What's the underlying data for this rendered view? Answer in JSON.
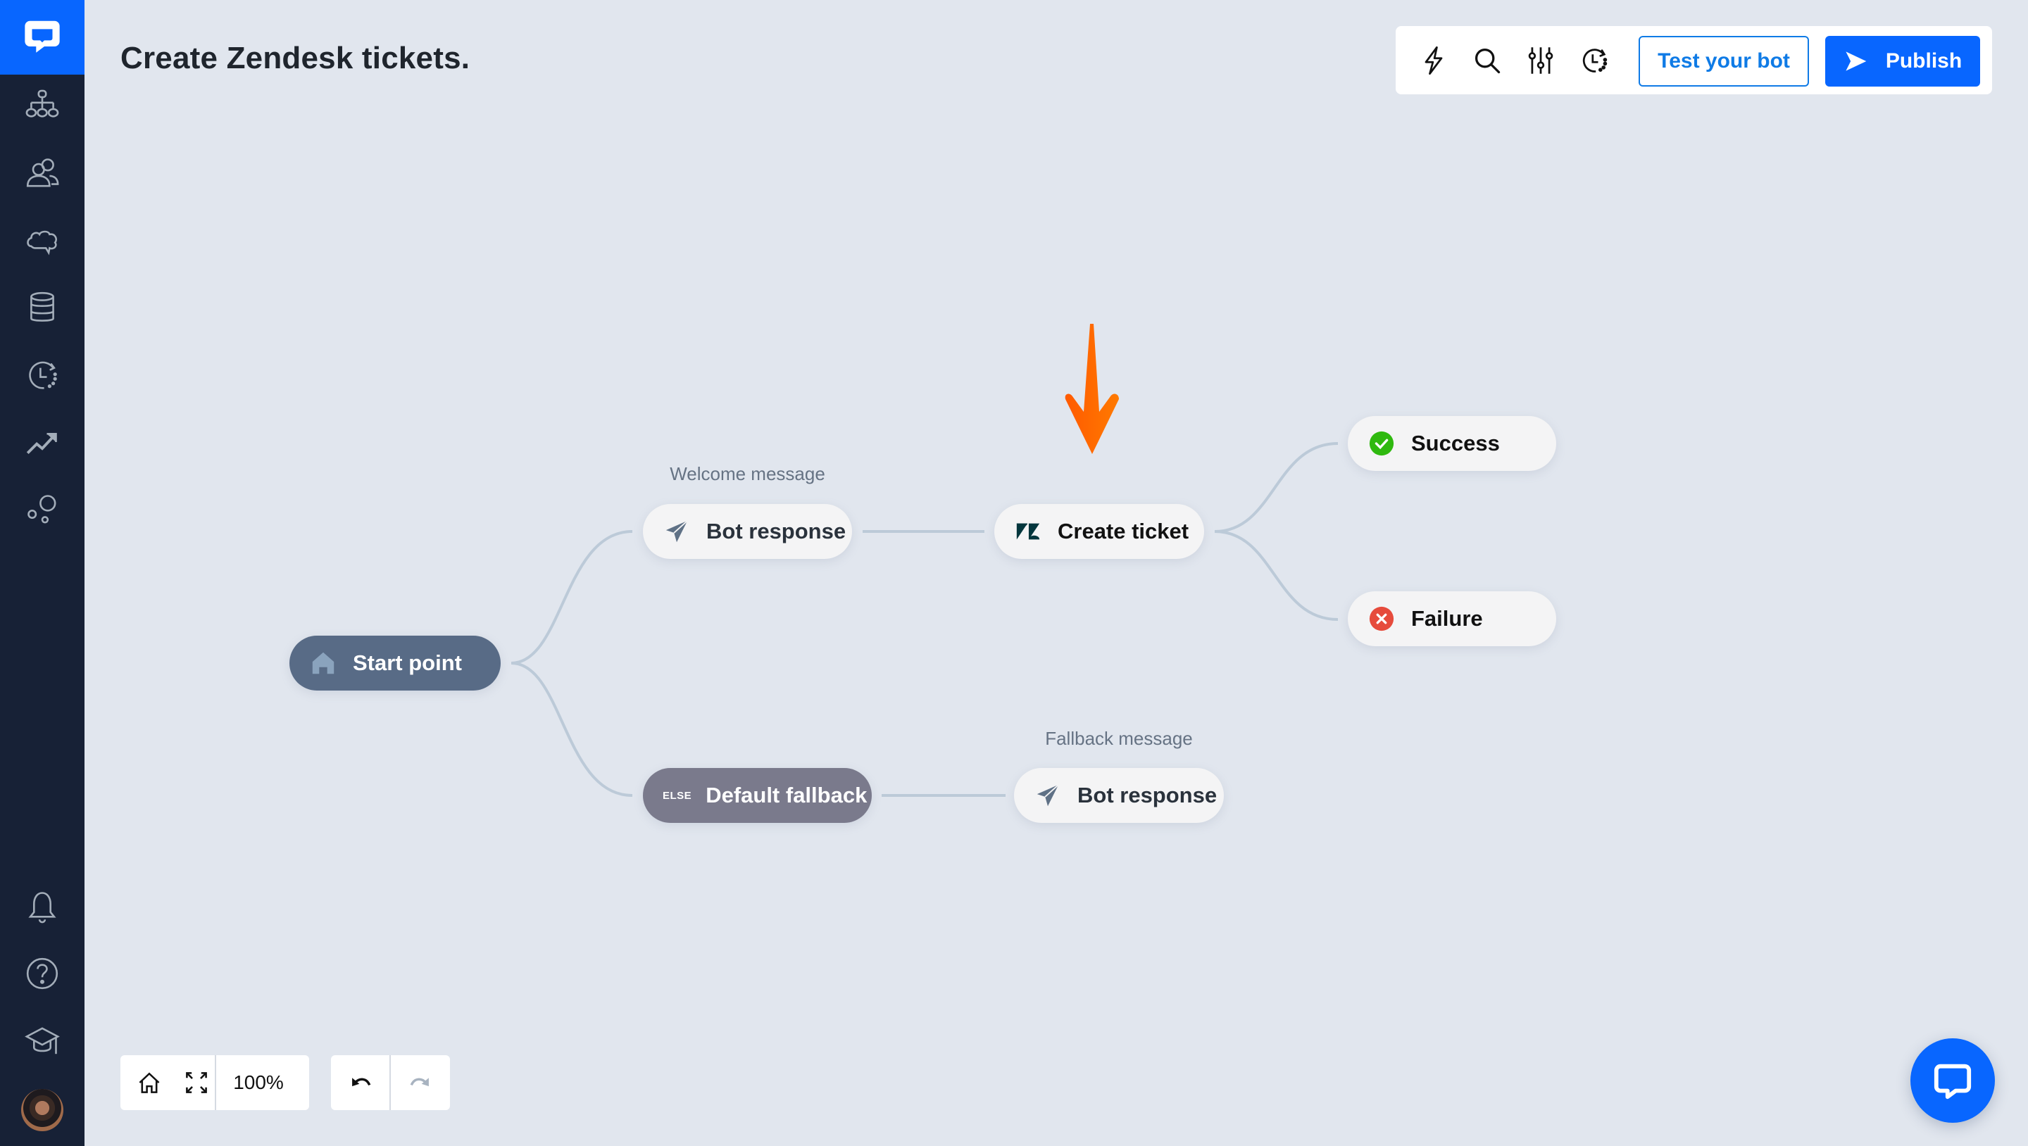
{
  "app": {
    "brand_color": "#0866ff",
    "sidebar_color": "#172136",
    "canvas_color": "#e1e6ee"
  },
  "sidebar": {
    "logo": "chat-bubble-logo-icon",
    "items": [
      {
        "name": "stories",
        "icon": "flow-tree-icon"
      },
      {
        "name": "audience",
        "icon": "users-icon"
      },
      {
        "name": "training",
        "icon": "brain-cloud-icon"
      },
      {
        "name": "data",
        "icon": "database-icon"
      },
      {
        "name": "history",
        "icon": "history-clock-icon"
      },
      {
        "name": "reports",
        "icon": "trending-up-icon"
      },
      {
        "name": "integrations",
        "icon": "bubbles-icon"
      }
    ],
    "bottom_items": [
      {
        "name": "notifications",
        "icon": "bell-icon"
      },
      {
        "name": "help",
        "icon": "help-circle-icon"
      },
      {
        "name": "academy",
        "icon": "graduation-cap-icon"
      },
      {
        "name": "profile",
        "icon": "avatar"
      }
    ]
  },
  "header": {
    "title": "Create Zendesk tickets."
  },
  "toolbar": {
    "icons": [
      "lightning-icon",
      "search-icon",
      "sliders-icon",
      "history-clock-icon"
    ],
    "test_label": "Test your bot",
    "publish_label": "Publish"
  },
  "flow": {
    "nodes": {
      "start": {
        "label": "Start point",
        "icon": "home-icon"
      },
      "welcome": {
        "caption": "Welcome message",
        "label": "Bot response",
        "icon": "paper-plane-icon"
      },
      "create_ticket": {
        "label": "Create ticket",
        "icon": "zendesk-icon"
      },
      "success": {
        "label": "Success",
        "icon": "check-circle-icon",
        "color": "#2fb90f"
      },
      "failure": {
        "label": "Failure",
        "icon": "x-circle-icon",
        "color": "#e64b3c"
      },
      "fallback": {
        "tag": "ELSE",
        "label": "Default fallback"
      },
      "fallback_response": {
        "caption": "Fallback message",
        "label": "Bot response",
        "icon": "paper-plane-icon"
      }
    },
    "highlight_arrow_color": "#ff6a00"
  },
  "controls": {
    "zoom_level": "100%",
    "buttons": [
      "home-icon",
      "fit-screen-icon",
      "undo-icon",
      "redo-icon"
    ]
  },
  "chat_widget": {
    "icon": "chat-bubble-icon"
  }
}
